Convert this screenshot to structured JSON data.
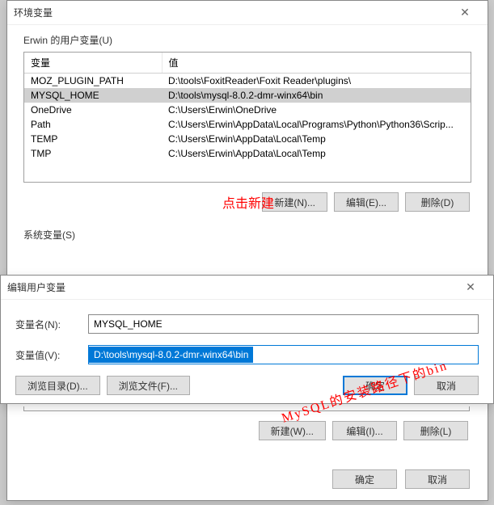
{
  "main_dialog": {
    "title": "环境变量",
    "user_vars_label": "Erwin 的用户变量(U)",
    "system_vars_label": "系统变量(S)",
    "columns": {
      "name": "变量",
      "value": "值"
    },
    "rows": [
      {
        "name": "MOZ_PLUGIN_PATH",
        "value": "D:\\tools\\FoxitReader\\Foxit Reader\\plugins\\",
        "selected": false
      },
      {
        "name": "MYSQL_HOME",
        "value": "D:\\tools\\mysql-8.0.2-dmr-winx64\\bin",
        "selected": true
      },
      {
        "name": "OneDrive",
        "value": "C:\\Users\\Erwin\\OneDrive",
        "selected": false
      },
      {
        "name": "Path",
        "value": "C:\\Users\\Erwin\\AppData\\Local\\Programs\\Python\\Python36\\Scrip...",
        "selected": false
      },
      {
        "name": "TEMP",
        "value": "C:\\Users\\Erwin\\AppData\\Local\\Temp",
        "selected": false
      },
      {
        "name": "TMP",
        "value": "C:\\Users\\Erwin\\AppData\\Local\\Temp",
        "selected": false
      }
    ],
    "user_buttons": {
      "new": "新建(N)...",
      "edit": "编辑(E)...",
      "delete": "删除(D)"
    },
    "sys_buttons": {
      "new": "新建(W)...",
      "edit": "编辑(I)...",
      "delete": "删除(L)"
    },
    "footer": {
      "ok": "确定",
      "cancel": "取消"
    }
  },
  "edit_dialog": {
    "title": "编辑用户变量",
    "name_label": "变量名(N):",
    "name_value": "MYSQL_HOME",
    "value_label": "变量值(V):",
    "value_value": "D:\\tools\\mysql-8.0.2-dmr-winx64\\bin",
    "browse_dir": "浏览目录(D)...",
    "browse_file": "浏览文件(F)...",
    "ok": "确定",
    "cancel": "取消"
  },
  "annotations": {
    "click_new": "点击新建",
    "mysql_path": "MySQL的安装路径下的bin"
  }
}
